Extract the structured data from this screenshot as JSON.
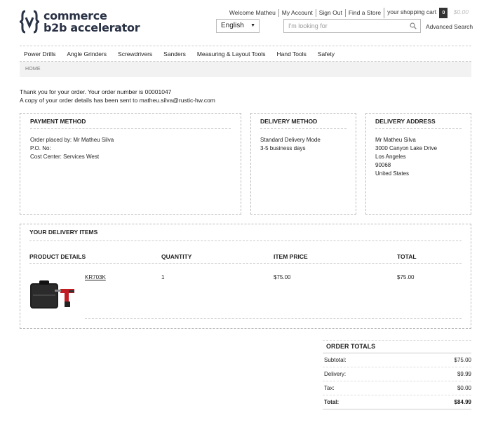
{
  "brand": {
    "line1": "commerce",
    "line2": "b2b accelerator",
    "logo_icon": "curly-v-logo-icon",
    "color": "#2a3245"
  },
  "header": {
    "welcome": "Welcome Matheu",
    "my_account": "My Account",
    "sign_out": "Sign Out",
    "find_store": "Find a Store",
    "cart_label": "your shopping cart",
    "cart_count": "0",
    "cart_total": "$0.00",
    "language": "English",
    "search_placeholder": "I'm looking for",
    "advanced_search": "Advanced Search"
  },
  "nav": [
    "Power Drills",
    "Angle Grinders",
    "Screwdrivers",
    "Sanders",
    "Measuring & Layout Tools",
    "Hand Tools",
    "Safety"
  ],
  "breadcrumb": "HOME",
  "confirmation": {
    "line1": "Thank you for your order. Your order number is 00001047",
    "line2": "A copy of your order details has been sent to matheu.silva@rustic-hw.com"
  },
  "payment": {
    "title": "PAYMENT METHOD",
    "placed_by": "Order placed by: Mr Matheu Silva",
    "po": "P.O. No:",
    "cost_center": "Cost Center: Services West"
  },
  "delivery_method": {
    "title": "DELIVERY METHOD",
    "mode": "Standard Delivery Mode",
    "days": "3-5 business days"
  },
  "delivery_address": {
    "title": "DELIVERY ADDRESS",
    "name": "Mr Matheu Silva",
    "street": "3000 Canyon Lake Drive",
    "city": "Los Angeles",
    "zip": "90068",
    "country": "United States"
  },
  "items": {
    "title": "YOUR DELIVERY ITEMS",
    "headers": {
      "product": "PRODUCT DETAILS",
      "quantity": "QUANTITY",
      "price": "ITEM PRICE",
      "total": "TOTAL"
    },
    "rows": [
      {
        "sku": "KR703K",
        "quantity": "1",
        "price": "$75.00",
        "total": "$75.00",
        "image_icon": "power-drill-kit-image"
      }
    ]
  },
  "totals": {
    "title": "ORDER TOTALS",
    "subtotal_label": "Subtotal:",
    "subtotal": "$75.00",
    "delivery_label": "Delivery:",
    "delivery": "$9.99",
    "tax_label": "Tax:",
    "tax": "$0.00",
    "total_label": "Total:",
    "total": "$84.99"
  }
}
